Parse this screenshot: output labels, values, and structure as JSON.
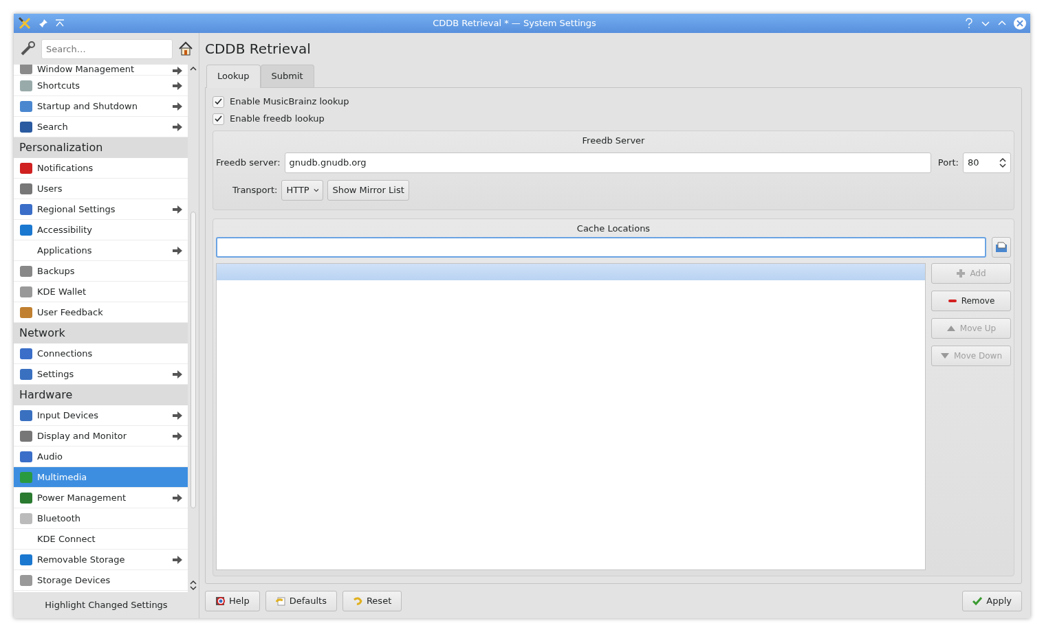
{
  "window": {
    "title": "CDDB Retrieval * — System Settings"
  },
  "sidebar": {
    "search": {
      "placeholder": "Search…"
    },
    "items": [
      {
        "kind": "item",
        "label": "Window Management",
        "has_children": true,
        "has_icon": true,
        "selected": false,
        "clipped": true
      },
      {
        "kind": "item",
        "label": "Shortcuts",
        "has_children": true,
        "has_icon": true,
        "selected": false
      },
      {
        "kind": "item",
        "label": "Startup and Shutdown",
        "has_children": true,
        "has_icon": true,
        "selected": false
      },
      {
        "kind": "item",
        "label": "Search",
        "has_children": true,
        "has_icon": true,
        "selected": false
      },
      {
        "kind": "header",
        "label": "Personalization"
      },
      {
        "kind": "item",
        "label": "Notifications",
        "has_children": false,
        "has_icon": true,
        "selected": false
      },
      {
        "kind": "item",
        "label": "Users",
        "has_children": false,
        "has_icon": true,
        "selected": false
      },
      {
        "kind": "item",
        "label": "Regional Settings",
        "has_children": true,
        "has_icon": true,
        "selected": false
      },
      {
        "kind": "item",
        "label": "Accessibility",
        "has_children": false,
        "has_icon": true,
        "selected": false
      },
      {
        "kind": "item",
        "label": "Applications",
        "has_children": true,
        "has_icon": false,
        "selected": false
      },
      {
        "kind": "item",
        "label": "Backups",
        "has_children": false,
        "has_icon": true,
        "selected": false
      },
      {
        "kind": "item",
        "label": "KDE Wallet",
        "has_children": false,
        "has_icon": true,
        "selected": false
      },
      {
        "kind": "item",
        "label": "User Feedback",
        "has_children": false,
        "has_icon": true,
        "selected": false
      },
      {
        "kind": "header",
        "label": "Network"
      },
      {
        "kind": "item",
        "label": "Connections",
        "has_children": false,
        "has_icon": true,
        "selected": false
      },
      {
        "kind": "item",
        "label": "Settings",
        "has_children": true,
        "has_icon": true,
        "selected": false
      },
      {
        "kind": "header",
        "label": "Hardware"
      },
      {
        "kind": "item",
        "label": "Input Devices",
        "has_children": true,
        "has_icon": true,
        "selected": false
      },
      {
        "kind": "item",
        "label": "Display and Monitor",
        "has_children": true,
        "has_icon": true,
        "selected": false
      },
      {
        "kind": "item",
        "label": "Audio",
        "has_children": false,
        "has_icon": true,
        "selected": false
      },
      {
        "kind": "item",
        "label": "Multimedia",
        "has_children": false,
        "has_icon": true,
        "selected": true
      },
      {
        "kind": "item",
        "label": "Power Management",
        "has_children": true,
        "has_icon": true,
        "selected": false
      },
      {
        "kind": "item",
        "label": "Bluetooth",
        "has_children": false,
        "has_icon": true,
        "selected": false
      },
      {
        "kind": "item",
        "label": "KDE Connect",
        "has_children": false,
        "has_icon": false,
        "selected": false
      },
      {
        "kind": "item",
        "label": "Removable Storage",
        "has_children": true,
        "has_icon": true,
        "selected": false
      },
      {
        "kind": "item",
        "label": "Storage Devices",
        "has_children": false,
        "has_icon": true,
        "selected": false
      }
    ],
    "footer": "Highlight Changed Settings"
  },
  "page": {
    "title": "CDDB Retrieval",
    "tabs": [
      {
        "label": "Lookup",
        "selected": true
      },
      {
        "label": "Submit",
        "selected": false
      }
    ],
    "checkboxes": [
      {
        "label": "Enable MusicBrainz lookup",
        "checked": true
      },
      {
        "label": "Enable freedb lookup",
        "checked": true
      }
    ],
    "freedb_server": {
      "title": "Freedb Server",
      "server_label": "Freedb server:",
      "server_value": "gnudb.gnudb.org",
      "port_label": "Port:",
      "port_value": "80",
      "transport_label": "Transport:",
      "transport_value": "HTTP",
      "mirror_button": "Show Mirror List"
    },
    "cache_locations": {
      "title": "Cache Locations",
      "buttons": [
        {
          "kind": "add",
          "label": "Add",
          "disabled": true
        },
        {
          "kind": "remove",
          "label": "Remove",
          "disabled": false
        },
        {
          "kind": "up",
          "label": "Move Up",
          "disabled": true
        },
        {
          "kind": "down",
          "label": "Move Down",
          "disabled": true
        }
      ]
    },
    "buttons": [
      {
        "kind": "help",
        "label": "Help"
      },
      {
        "kind": "defaults",
        "label": "Defaults"
      },
      {
        "kind": "reset",
        "label": "Reset"
      },
      {
        "kind": "apply",
        "label": "Apply"
      }
    ]
  }
}
